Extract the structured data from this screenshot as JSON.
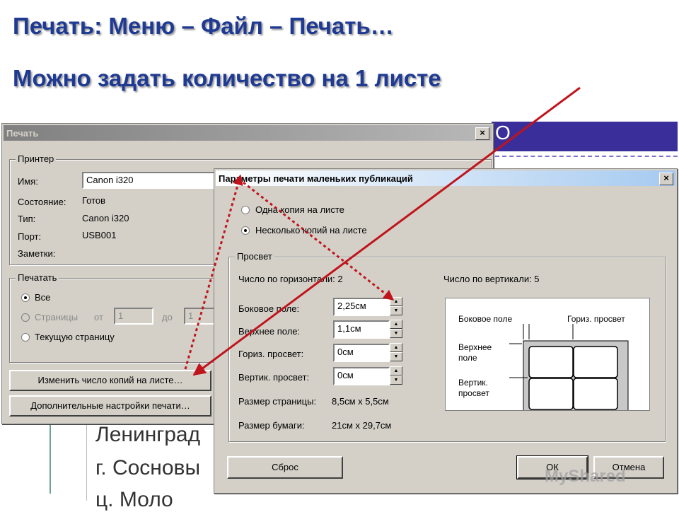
{
  "slide": {
    "title_line1": "Печать: Меню – Файл – Печать…",
    "title_line2": "Можно задать количество на 1 листе"
  },
  "background_doc": {
    "band_text": "O",
    "line1": "Ленинград",
    "line2": "г. Сосновы",
    "line3": "ц.  Моло"
  },
  "print_dialog": {
    "title": "Печать",
    "close": "×",
    "printer_group": "Принтер",
    "name_label": "Имя:",
    "name_value": "Canon i320",
    "state_label": "Состояние:",
    "state_value": "Готов",
    "type_label": "Тип:",
    "type_value": "Canon i320",
    "port_label": "Порт:",
    "port_value": "USB001",
    "notes_label": "Заметки:",
    "print_group": "Печатать",
    "opt_all": "Все",
    "opt_pages": "Страницы",
    "from_label": "от",
    "from_value": "1",
    "to_label": "до",
    "to_value": "1",
    "opt_current": "Текущую страницу",
    "btn_change_copies": "Изменить число копий на листе…",
    "btn_more_settings": "Дополнительные настройки печати…"
  },
  "params_dialog": {
    "title": "Параметры печати маленьких публикаций",
    "close": "×",
    "opt_one_copy": "Одна копия на листе",
    "opt_multi_copy": "Несколько копий на листе",
    "gap_group": "Просвет",
    "horiz_count": "Число по горизонтали: 2",
    "vert_count": "Число по вертикали: 5",
    "side_margin_label": "Боковое поле:",
    "side_margin_value": "2,25см",
    "top_margin_label": "Верхнее поле:",
    "top_margin_value": "1,1см",
    "horiz_gap_label": "Гориз. просвет:",
    "horiz_gap_value": "0см",
    "vert_gap_label": "Вертик. просвет:",
    "vert_gap_value": "0см",
    "page_size_label": "Размер страницы:",
    "page_size_value": "8,5см x 5,5см",
    "paper_size_label": "Размер бумаги:",
    "paper_size_value": "21см x 29,7см",
    "preview": {
      "side_margin": "Боковое поле",
      "horiz_gap": "Гориз. просвет",
      "top_margin_1": "Верхнее",
      "top_margin_2": "поле",
      "vert_gap_1": "Вертик.",
      "vert_gap_2": "просвет"
    },
    "btn_reset": "Сброс",
    "btn_ok": "ОК",
    "btn_cancel": "Отмена"
  },
  "watermark": "MyShared",
  "colors": {
    "title": "#1f3a93",
    "arrow": "#c0141c",
    "dialog_face": "#d4d0c8",
    "bg_band": "#3a2f9a"
  }
}
